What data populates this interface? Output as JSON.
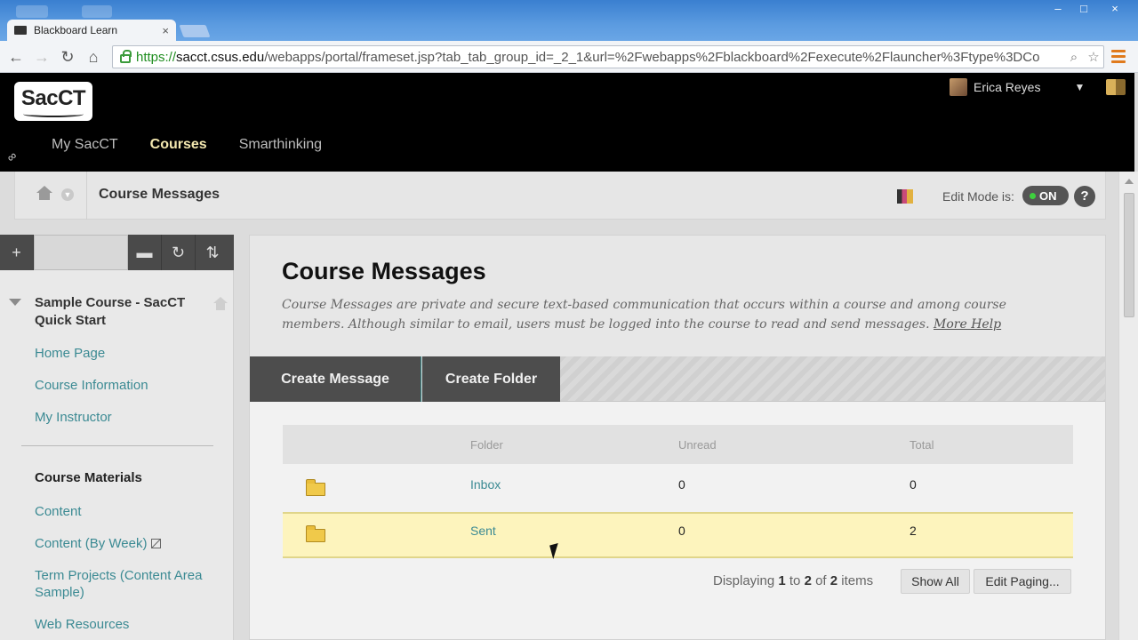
{
  "browser": {
    "tab_title": "Blackboard Learn",
    "tab_close": "×",
    "url_scheme": "https://",
    "url_host": "sacct.csus.edu",
    "url_path": "/webapps/portal/frameset.jsp?tab_tab_group_id=_2_1&url=%2Fwebapps%2Fblackboard%2Fexecute%2Flauncher%3Ftype%3DCo",
    "window_controls": [
      "–",
      "□",
      "×"
    ],
    "icons": [
      "back-arrow-icon",
      "forward-arrow-icon",
      "reload-icon",
      "home-icon",
      "lock-icon",
      "search-icon",
      "star-icon",
      "menu-icon"
    ]
  },
  "site": {
    "logo_text": "SacCT",
    "user_name": "Erica Reyes",
    "tabs": [
      {
        "label": "My SacCT",
        "active": false
      },
      {
        "label": "Courses",
        "active": true
      },
      {
        "label": "Smarthinking",
        "active": false
      }
    ]
  },
  "breadcrumb": {
    "current": "Course Messages",
    "edit_mode_label": "Edit Mode is:",
    "edit_mode_state": "ON",
    "help": "?"
  },
  "menu_tools": {
    "add": "+",
    "folder": "▬",
    "refresh": "↻",
    "sort": "⇅"
  },
  "course_menu": {
    "course_title": "Sample Course - SacCT Quick Start",
    "links_top": [
      "Home Page",
      "Course Information",
      "My Instructor"
    ],
    "heading": "Course Materials",
    "links_bottom": [
      "Content",
      "Content (By Week)",
      "Term Projects (Content Area Sample)",
      "Web Resources"
    ]
  },
  "main": {
    "title": "Course Messages",
    "description": "Course Messages are private and secure text-based communication that occurs within a course and among course members. Although similar to email, users must be logged into the course to read and send messages.",
    "more_help": "More Help",
    "actions": {
      "create_message": "Create Message",
      "create_folder": "Create Folder"
    },
    "table": {
      "headers": {
        "folder": "Folder",
        "unread": "Unread",
        "total": "Total"
      },
      "rows": [
        {
          "folder": "Inbox",
          "unread": "0",
          "total": "0"
        },
        {
          "folder": "Sent",
          "unread": "0",
          "total": "2"
        }
      ]
    },
    "pager": {
      "prefix": "Displaying",
      "from": "1",
      "to_word": "to",
      "to": "2",
      "of_word": "of",
      "total": "2",
      "suffix": "items"
    },
    "show_all": "Show All",
    "edit_paging": "Edit Paging..."
  },
  "colors": {
    "link": "#3b8a93",
    "selected_row": "#fdf4bd",
    "active_tab": "#f4e8b0",
    "toggle_on": "#3ed03e"
  }
}
